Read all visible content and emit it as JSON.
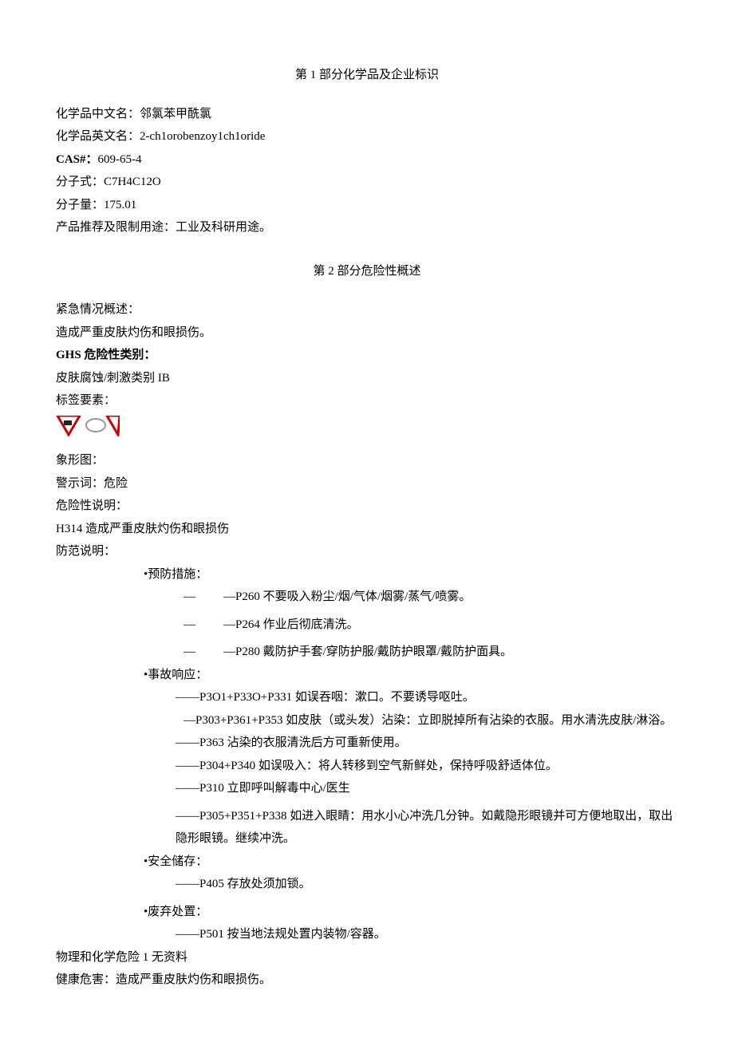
{
  "section1": {
    "heading": "第 1 部分化学品及企业标识",
    "name_cn_label": "化学品中文名：",
    "name_cn_value": "邻氯苯甲酰氯",
    "name_en_label": "化学品英文名：",
    "name_en_value": "2-ch1orobenzoy1ch1oride",
    "cas_label": "CAS#：",
    "cas_value": "609-65-4",
    "formula_label": "分子式：",
    "formula_value": "C7H4C12O",
    "mw_label": "分子量：",
    "mw_value": "175.01",
    "use_label": "产品推荐及限制用途：",
    "use_value": "工业及科研用途。"
  },
  "section2": {
    "heading": "第 2 部分危险性概述",
    "emergency_label": "紧急情况概述：",
    "emergency_text": "造成严重皮肤灼伤和眼损伤。",
    "ghs_label": "GHS 危险性类别：",
    "ghs_text": "皮肤腐蚀/刺激类别 IB",
    "label_elements": "标签要素：",
    "pictogram_label": "象形图：",
    "signal_label": "警示词：",
    "signal_value": "危险",
    "hazard_stmt_label": "危险性说明：",
    "hazard_stmt_text": "H314 造成严重皮肤灼伤和眼损伤",
    "precaution_label": "防范说明：",
    "prevention": {
      "title": "•预防措施：",
      "dash": "—",
      "p260": "—P260 不要吸入粉尘/烟/气体/烟雾/蒸气/喷雾。",
      "p264": "—P264 作业后彻底清洗。",
      "p280": "—P280 戴防护手套/穿防护服/戴防护眼罩/戴防护面具。"
    },
    "response": {
      "title": "•事故响应：",
      "p301": "——P3O1+P33O+P331 如误吞咽：漱口。不要诱导呕吐。",
      "p303": "—P303+P361+P353 如皮肤（或头发）沾染：立即脱掉所有沾染的衣服。用水清洗皮肤/淋浴。",
      "p363": "——P363 沾染的衣服清洗后方可重新使用。",
      "p304": "——P304+P340 如误吸入：将人转移到空气新鲜处，保持呼吸舒适体位。",
      "p310": "——P310 立即呼叫解毒中心/医生",
      "p305": "——P305+P351+P338 如进入眼睛：用水小心冲洗几分钟。如戴隐形眼镜并可方便地取出，取出隐形眼镜。继续冲洗。"
    },
    "storage": {
      "title": "•安全储存：",
      "p405": "——P405 存放处须加锁。"
    },
    "disposal": {
      "title": "•废弃处置：",
      "p501": "——P501 按当地法规处置内装物/容器。"
    },
    "phys_chem": "物理和化学危险 1 无资料",
    "health_label": "健康危害：",
    "health_value": "造成严重皮肤灼伤和眼损伤。"
  }
}
